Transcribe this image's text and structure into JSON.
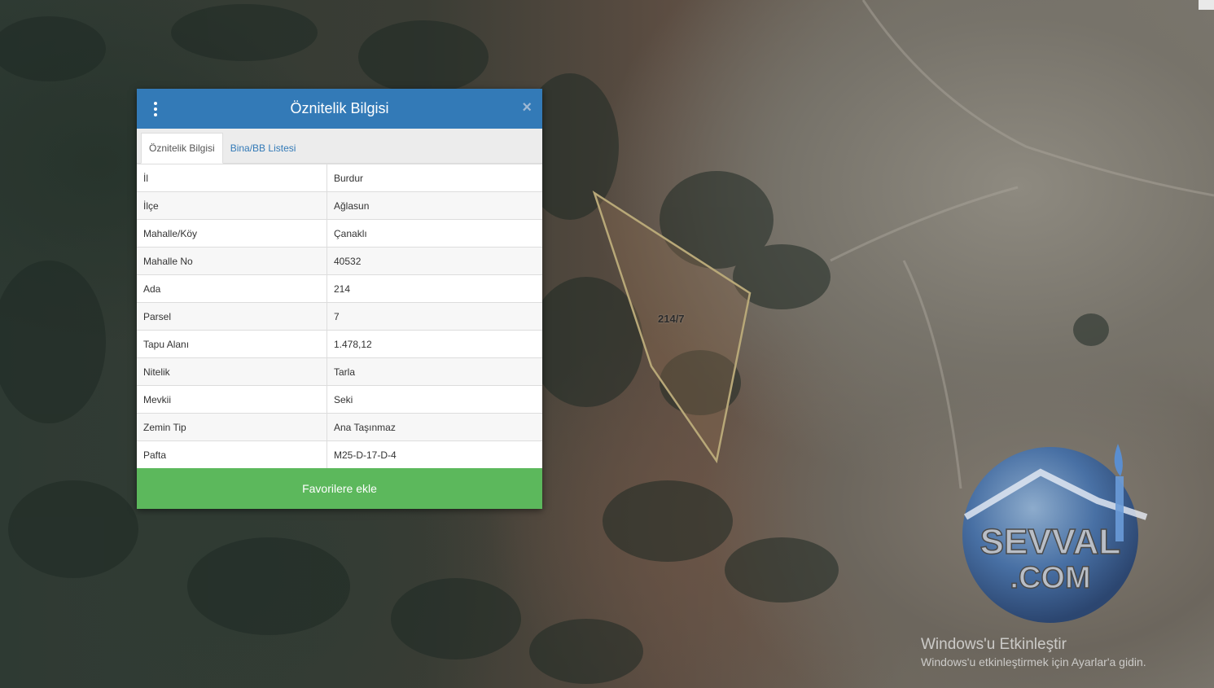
{
  "panel": {
    "title": "Öznitelik Bilgisi",
    "close_symbol": "×",
    "tabs": [
      {
        "label": "Öznitelik Bilgisi",
        "active": true
      },
      {
        "label": "Bina/BB Listesi",
        "active": false
      }
    ],
    "rows": [
      {
        "key": "İl",
        "value": "Burdur"
      },
      {
        "key": "İlçe",
        "value": "Ağlasun"
      },
      {
        "key": "Mahalle/Köy",
        "value": "Çanaklı"
      },
      {
        "key": "Mahalle No",
        "value": "40532"
      },
      {
        "key": "Ada",
        "value": "214"
      },
      {
        "key": "Parsel",
        "value": "7"
      },
      {
        "key": "Tapu Alanı",
        "value": "1.478,12"
      },
      {
        "key": "Nitelik",
        "value": "Tarla"
      },
      {
        "key": "Mevkii",
        "value": "Seki"
      },
      {
        "key": "Zemin Tip",
        "value": "Ana Taşınmaz"
      },
      {
        "key": "Pafta",
        "value": "M25-D-17-D-4"
      }
    ],
    "favorite_button": "Favorilere ekle"
  },
  "map": {
    "parcel_label": "214/7",
    "parcel_outline_color": "#b8a878"
  },
  "watermark": {
    "logo_text_top": "SEVVAL",
    "logo_text_bottom": ".COM"
  },
  "activation": {
    "title": "Windows'u Etkinleştir",
    "subtitle": "Windows'u etkinleştirmek için Ayarlar'a gidin."
  },
  "colors": {
    "header": "#337ab7",
    "button": "#5cb85c"
  }
}
